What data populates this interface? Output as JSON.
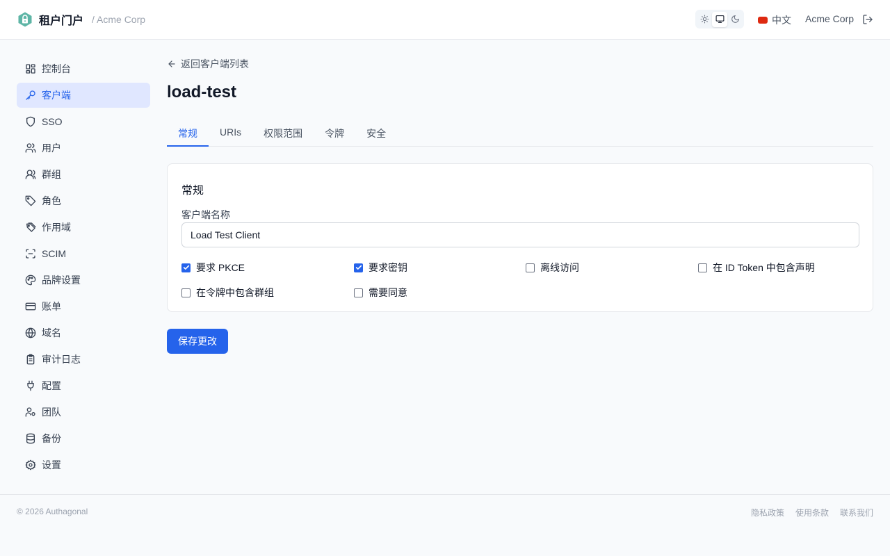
{
  "header": {
    "app_name": "租户门户",
    "tenant": "/ Acme Corp",
    "logo_icon": "lock-hexagon-icon",
    "theme_options": [
      "sun-icon",
      "monitor-icon",
      "moon-icon"
    ],
    "theme_selected": "monitor-icon",
    "language_label": "中文",
    "org_name": "Acme Corp",
    "logout_icon": "logout-icon"
  },
  "sidebar": {
    "items": [
      {
        "label": "控制台",
        "icon": "dashboard-icon",
        "active": false
      },
      {
        "label": "客户端",
        "icon": "key-icon",
        "active": true
      },
      {
        "label": "SSO",
        "icon": "shield-icon",
        "active": false
      },
      {
        "label": "用户",
        "icon": "users-icon",
        "active": false
      },
      {
        "label": "群组",
        "icon": "user-group-icon",
        "active": false
      },
      {
        "label": "角色",
        "icon": "tag-icon",
        "active": false
      },
      {
        "label": "作用域",
        "icon": "tags-icon",
        "active": false
      },
      {
        "label": "SCIM",
        "icon": "scan-icon",
        "active": false
      },
      {
        "label": "品牌设置",
        "icon": "palette-icon",
        "active": false
      },
      {
        "label": "账单",
        "icon": "credit-card-icon",
        "active": false
      },
      {
        "label": "域名",
        "icon": "globe-icon",
        "active": false
      },
      {
        "label": "审计日志",
        "icon": "clipboard-icon",
        "active": false
      },
      {
        "label": "配置",
        "icon": "plug-icon",
        "active": false
      },
      {
        "label": "团队",
        "icon": "user-cog-icon",
        "active": false
      },
      {
        "label": "备份",
        "icon": "database-icon",
        "active": false
      },
      {
        "label": "设置",
        "icon": "gear-icon",
        "active": false
      }
    ]
  },
  "main": {
    "back_label": "返回客户端列表",
    "title": "load-test",
    "tabs": [
      {
        "label": "常规",
        "active": true
      },
      {
        "label": "URIs",
        "active": false
      },
      {
        "label": "权限范围",
        "active": false
      },
      {
        "label": "令牌",
        "active": false
      },
      {
        "label": "安全",
        "active": false
      }
    ],
    "card": {
      "title": "常规",
      "client_name_label": "客户端名称",
      "client_name_value": "Load Test Client",
      "options": [
        {
          "label": "要求 PKCE",
          "checked": true
        },
        {
          "label": "要求密钥",
          "checked": true
        },
        {
          "label": "离线访问",
          "checked": false
        },
        {
          "label": "在 ID Token 中包含声明",
          "checked": false
        },
        {
          "label": "在令牌中包含群组",
          "checked": false
        },
        {
          "label": "需要同意",
          "checked": false
        }
      ]
    },
    "save_label": "保存更改"
  },
  "footer": {
    "copyright": "© 2026 Authagonal",
    "links": [
      "隐私政策",
      "使用条款",
      "联系我们"
    ]
  },
  "colors": {
    "accent": "#2563eb",
    "active_bg": "#e0e7ff",
    "brand_logo": "#5eb5a6",
    "flag": "#de2910"
  }
}
